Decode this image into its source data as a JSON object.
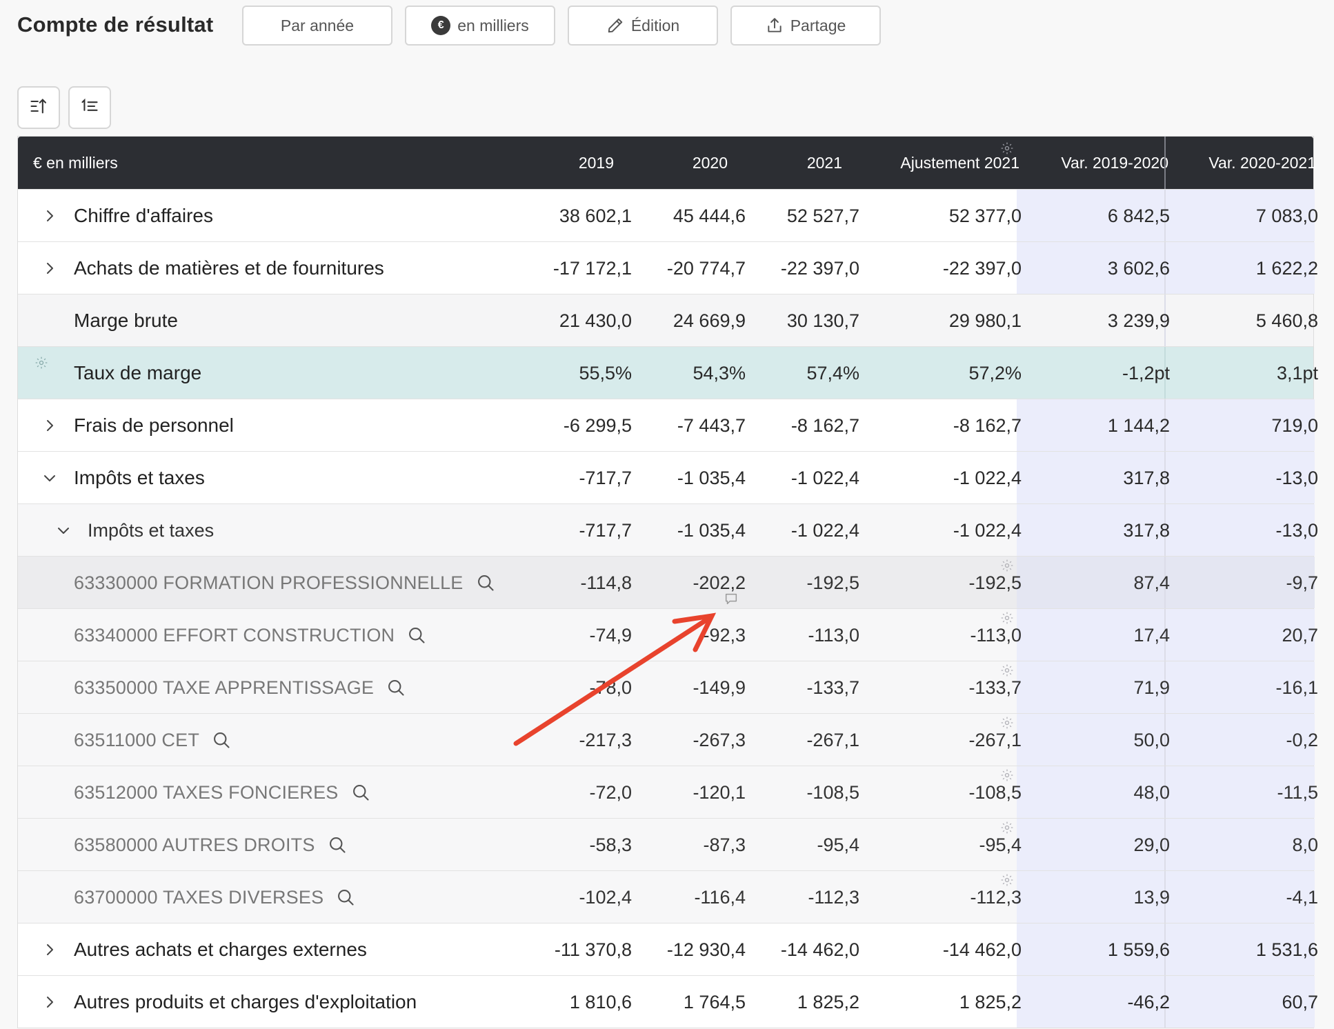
{
  "header": {
    "title": "Compte de résultat",
    "buttons": [
      {
        "label": "Par année",
        "icon": ""
      },
      {
        "label": "en milliers",
        "icon": "euro-badge-icon",
        "icon_text": "€"
      },
      {
        "label": "Édition",
        "icon": "pencil-icon"
      },
      {
        "label": "Partage",
        "icon": "share-icon"
      }
    ]
  },
  "toolbar": {
    "sort_buttons": [
      {
        "icon": "sort-ascending-icon"
      },
      {
        "icon": "sort-numeric-icon"
      }
    ]
  },
  "table": {
    "columns": [
      "€ en milliers",
      "2019",
      "2020",
      "2021",
      "Ajustement 2021",
      "Var. 2019-2020",
      "Var. 2020-2021"
    ],
    "rows": [
      {
        "type": "group",
        "expand": "collapsed",
        "label": "Chiffre d'affaires",
        "values": [
          "38 602,1",
          "45 444,6",
          "52 527,7",
          "52 377,0",
          "6 842,5",
          "7 083,0"
        ]
      },
      {
        "type": "group",
        "expand": "collapsed",
        "label": "Achats de matières et de fournitures",
        "values": [
          "-17 172,1",
          "-20 774,7",
          "-22 397,0",
          "-22 397,0",
          "3 602,6",
          "1 622,2"
        ]
      },
      {
        "type": "total",
        "expand": "none",
        "label": "Marge brute",
        "values": [
          "21 430,0",
          "24 669,9",
          "30 130,7",
          "29 980,1",
          "3 239,9",
          "5 460,8"
        ]
      },
      {
        "type": "rate",
        "expand": "none",
        "label": "Taux de marge",
        "values": [
          "55,5%",
          "54,3%",
          "57,4%",
          "57,2%",
          "-1,2pt",
          "3,1pt"
        ]
      },
      {
        "type": "group",
        "expand": "collapsed",
        "label": "Frais de personnel",
        "values": [
          "-6 299,5",
          "-7 443,7",
          "-8 162,7",
          "-8 162,7",
          "1 144,2",
          "719,0"
        ]
      },
      {
        "type": "group",
        "expand": "expanded",
        "label": "Impôts et taxes",
        "values": [
          "-717,7",
          "-1 035,4",
          "-1 022,4",
          "-1 022,4",
          "317,8",
          "-13,0"
        ]
      },
      {
        "type": "subgroup",
        "expand": "expanded",
        "label": "Impôts et taxes",
        "values": [
          "-717,7",
          "-1 035,4",
          "-1 022,4",
          "-1 022,4",
          "317,8",
          "-13,0"
        ]
      },
      {
        "type": "account",
        "hover": true,
        "label": "63330000 FORMATION PROFESSIONNELLE",
        "values": [
          "-114,8",
          "-202,2",
          "-192,5",
          "-192,5",
          "87,4",
          "-9,7"
        ]
      },
      {
        "type": "account",
        "label": "63340000 EFFORT CONSTRUCTION",
        "values": [
          "-74,9",
          "-92,3",
          "-113,0",
          "-113,0",
          "17,4",
          "20,7"
        ]
      },
      {
        "type": "account",
        "label": "63350000 TAXE APPRENTISSAGE",
        "values": [
          "-78,0",
          "-149,9",
          "-133,7",
          "-133,7",
          "71,9",
          "-16,1"
        ]
      },
      {
        "type": "account",
        "label": "63511000 CET",
        "values": [
          "-217,3",
          "-267,3",
          "-267,1",
          "-267,1",
          "50,0",
          "-0,2"
        ]
      },
      {
        "type": "account",
        "label": "63512000 TAXES FONCIERES",
        "values": [
          "-72,0",
          "-120,1",
          "-108,5",
          "-108,5",
          "48,0",
          "-11,5"
        ]
      },
      {
        "type": "account",
        "label": "63580000 AUTRES DROITS",
        "values": [
          "-58,3",
          "-87,3",
          "-95,4",
          "-95,4",
          "29,0",
          "8,0"
        ]
      },
      {
        "type": "account",
        "label": "63700000 TAXES DIVERSES",
        "values": [
          "-102,4",
          "-116,4",
          "-112,3",
          "-112,3",
          "13,9",
          "-4,1"
        ]
      },
      {
        "type": "group",
        "expand": "collapsed",
        "label": "Autres achats et charges externes",
        "values": [
          "-11 370,8",
          "-12 930,4",
          "-14 462,0",
          "-14 462,0",
          "1 559,6",
          "1 531,6"
        ]
      },
      {
        "type": "group",
        "expand": "collapsed",
        "label": "Autres produits et charges d'exploitation",
        "values": [
          "1 810,6",
          "1 764,5",
          "1 825,2",
          "1 825,2",
          "-46,2",
          "60,7"
        ]
      }
    ]
  },
  "annotation": {
    "arrow_color": "#e8432d",
    "points_to": "comment-icon"
  },
  "colors": {
    "header_bg": "#2c2e33",
    "rate_row_bg": "#d7ebeb",
    "variance_bg": "#ebedfb"
  }
}
